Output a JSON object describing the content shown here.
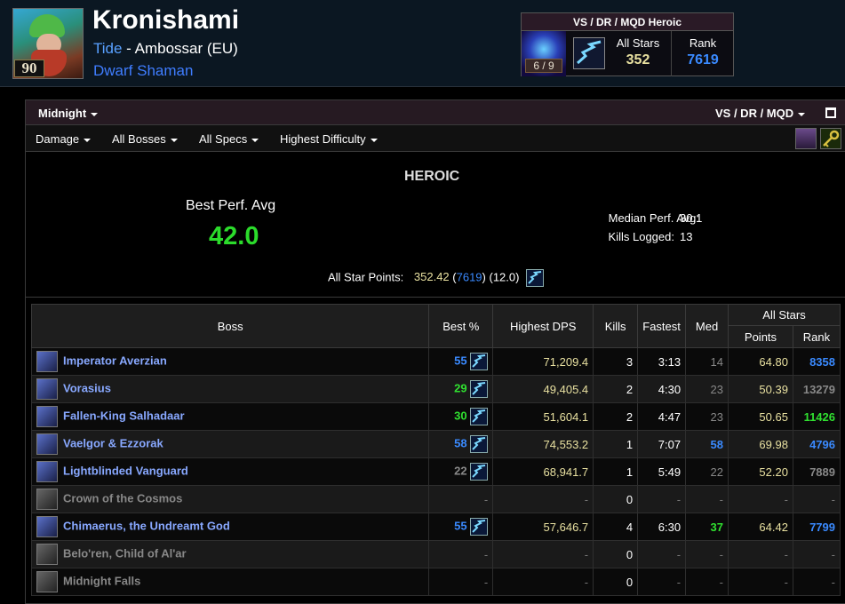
{
  "character": {
    "level": "90",
    "name": "Kronishami",
    "guild": "Tide",
    "realm_sep": " - ",
    "realm": "Ambossar (EU)",
    "class_line": "Dwarf Shaman"
  },
  "stats_box": {
    "title": "VS / DR / MQD Heroic",
    "raid_progress": "6 / 9",
    "all_stars_label": "All Stars",
    "all_stars_value": "352",
    "rank_label": "Rank",
    "rank_value": "7619"
  },
  "topbar": {
    "zone": "Midnight",
    "raid_select": "VS / DR / MQD"
  },
  "filters": {
    "metric": "Damage",
    "bosses": "All Bosses",
    "specs": "All Specs",
    "difficulty": "Highest Difficulty"
  },
  "summary": {
    "difficulty": "HEROIC",
    "best_perf_label": "Best Perf. Avg",
    "best_perf_value": "42.0",
    "median_label": "Median Perf. Avg:",
    "median_value": "30.1",
    "kills_label": "Kills Logged:",
    "kills_value": "13",
    "asp_label": "All Star Points:",
    "asp_points": "352.42",
    "asp_open": " (",
    "asp_rank": "7619",
    "asp_close": ")",
    "asp_extra": " (12.0)"
  },
  "table": {
    "headers": {
      "boss": "Boss",
      "best": "Best %",
      "dps": "Highest DPS",
      "kills": "Kills",
      "fastest": "Fastest",
      "med": "Med",
      "all_stars": "All Stars",
      "points": "Points",
      "rank": "Rank"
    },
    "rows": [
      {
        "boss": "Imperator Averzian",
        "best": "55",
        "dps": "71,209.4",
        "kills": "3",
        "fastest": "3:13",
        "med": "14",
        "points": "64.80",
        "rank": "8358"
      },
      {
        "boss": "Vorasius",
        "best": "29",
        "dps": "49,405.4",
        "kills": "2",
        "fastest": "4:30",
        "med": "23",
        "points": "50.39",
        "rank": "13279"
      },
      {
        "boss": "Fallen-King Salhadaar",
        "best": "30",
        "dps": "51,604.1",
        "kills": "2",
        "fastest": "4:47",
        "med": "23",
        "points": "50.65",
        "rank": "11426"
      },
      {
        "boss": "Vaelgor & Ezzorak",
        "best": "58",
        "dps": "74,553.2",
        "kills": "1",
        "fastest": "7:07",
        "med": "58",
        "points": "69.98",
        "rank": "4796"
      },
      {
        "boss": "Lightblinded Vanguard",
        "best": "22",
        "dps": "68,941.7",
        "kills": "1",
        "fastest": "5:49",
        "med": "22",
        "points": "52.20",
        "rank": "7889"
      },
      {
        "boss": "Crown of the Cosmos",
        "best": "-",
        "dps": "-",
        "kills": "0",
        "fastest": "-",
        "med": "-",
        "points": "-",
        "rank": "-"
      },
      {
        "boss": "Chimaerus, the Undreamt God",
        "best": "55",
        "dps": "57,646.7",
        "kills": "4",
        "fastest": "6:30",
        "med": "37",
        "points": "64.42",
        "rank": "7799"
      },
      {
        "boss": "Belo'ren, Child of Al'ar",
        "best": "-",
        "dps": "-",
        "kills": "0",
        "fastest": "-",
        "med": "-",
        "points": "-",
        "rank": "-"
      },
      {
        "boss": "Midnight Falls",
        "best": "-",
        "dps": "-",
        "kills": "0",
        "fastest": "-",
        "med": "-",
        "points": "-",
        "rank": "-"
      }
    ]
  },
  "colors": {
    "best_perf": "#2bdb2b",
    "rare_blue": "#3a8aff",
    "uncommon_green": "#30e030",
    "common_gray": "#888888",
    "points_yellow": "#e8e0a0"
  }
}
